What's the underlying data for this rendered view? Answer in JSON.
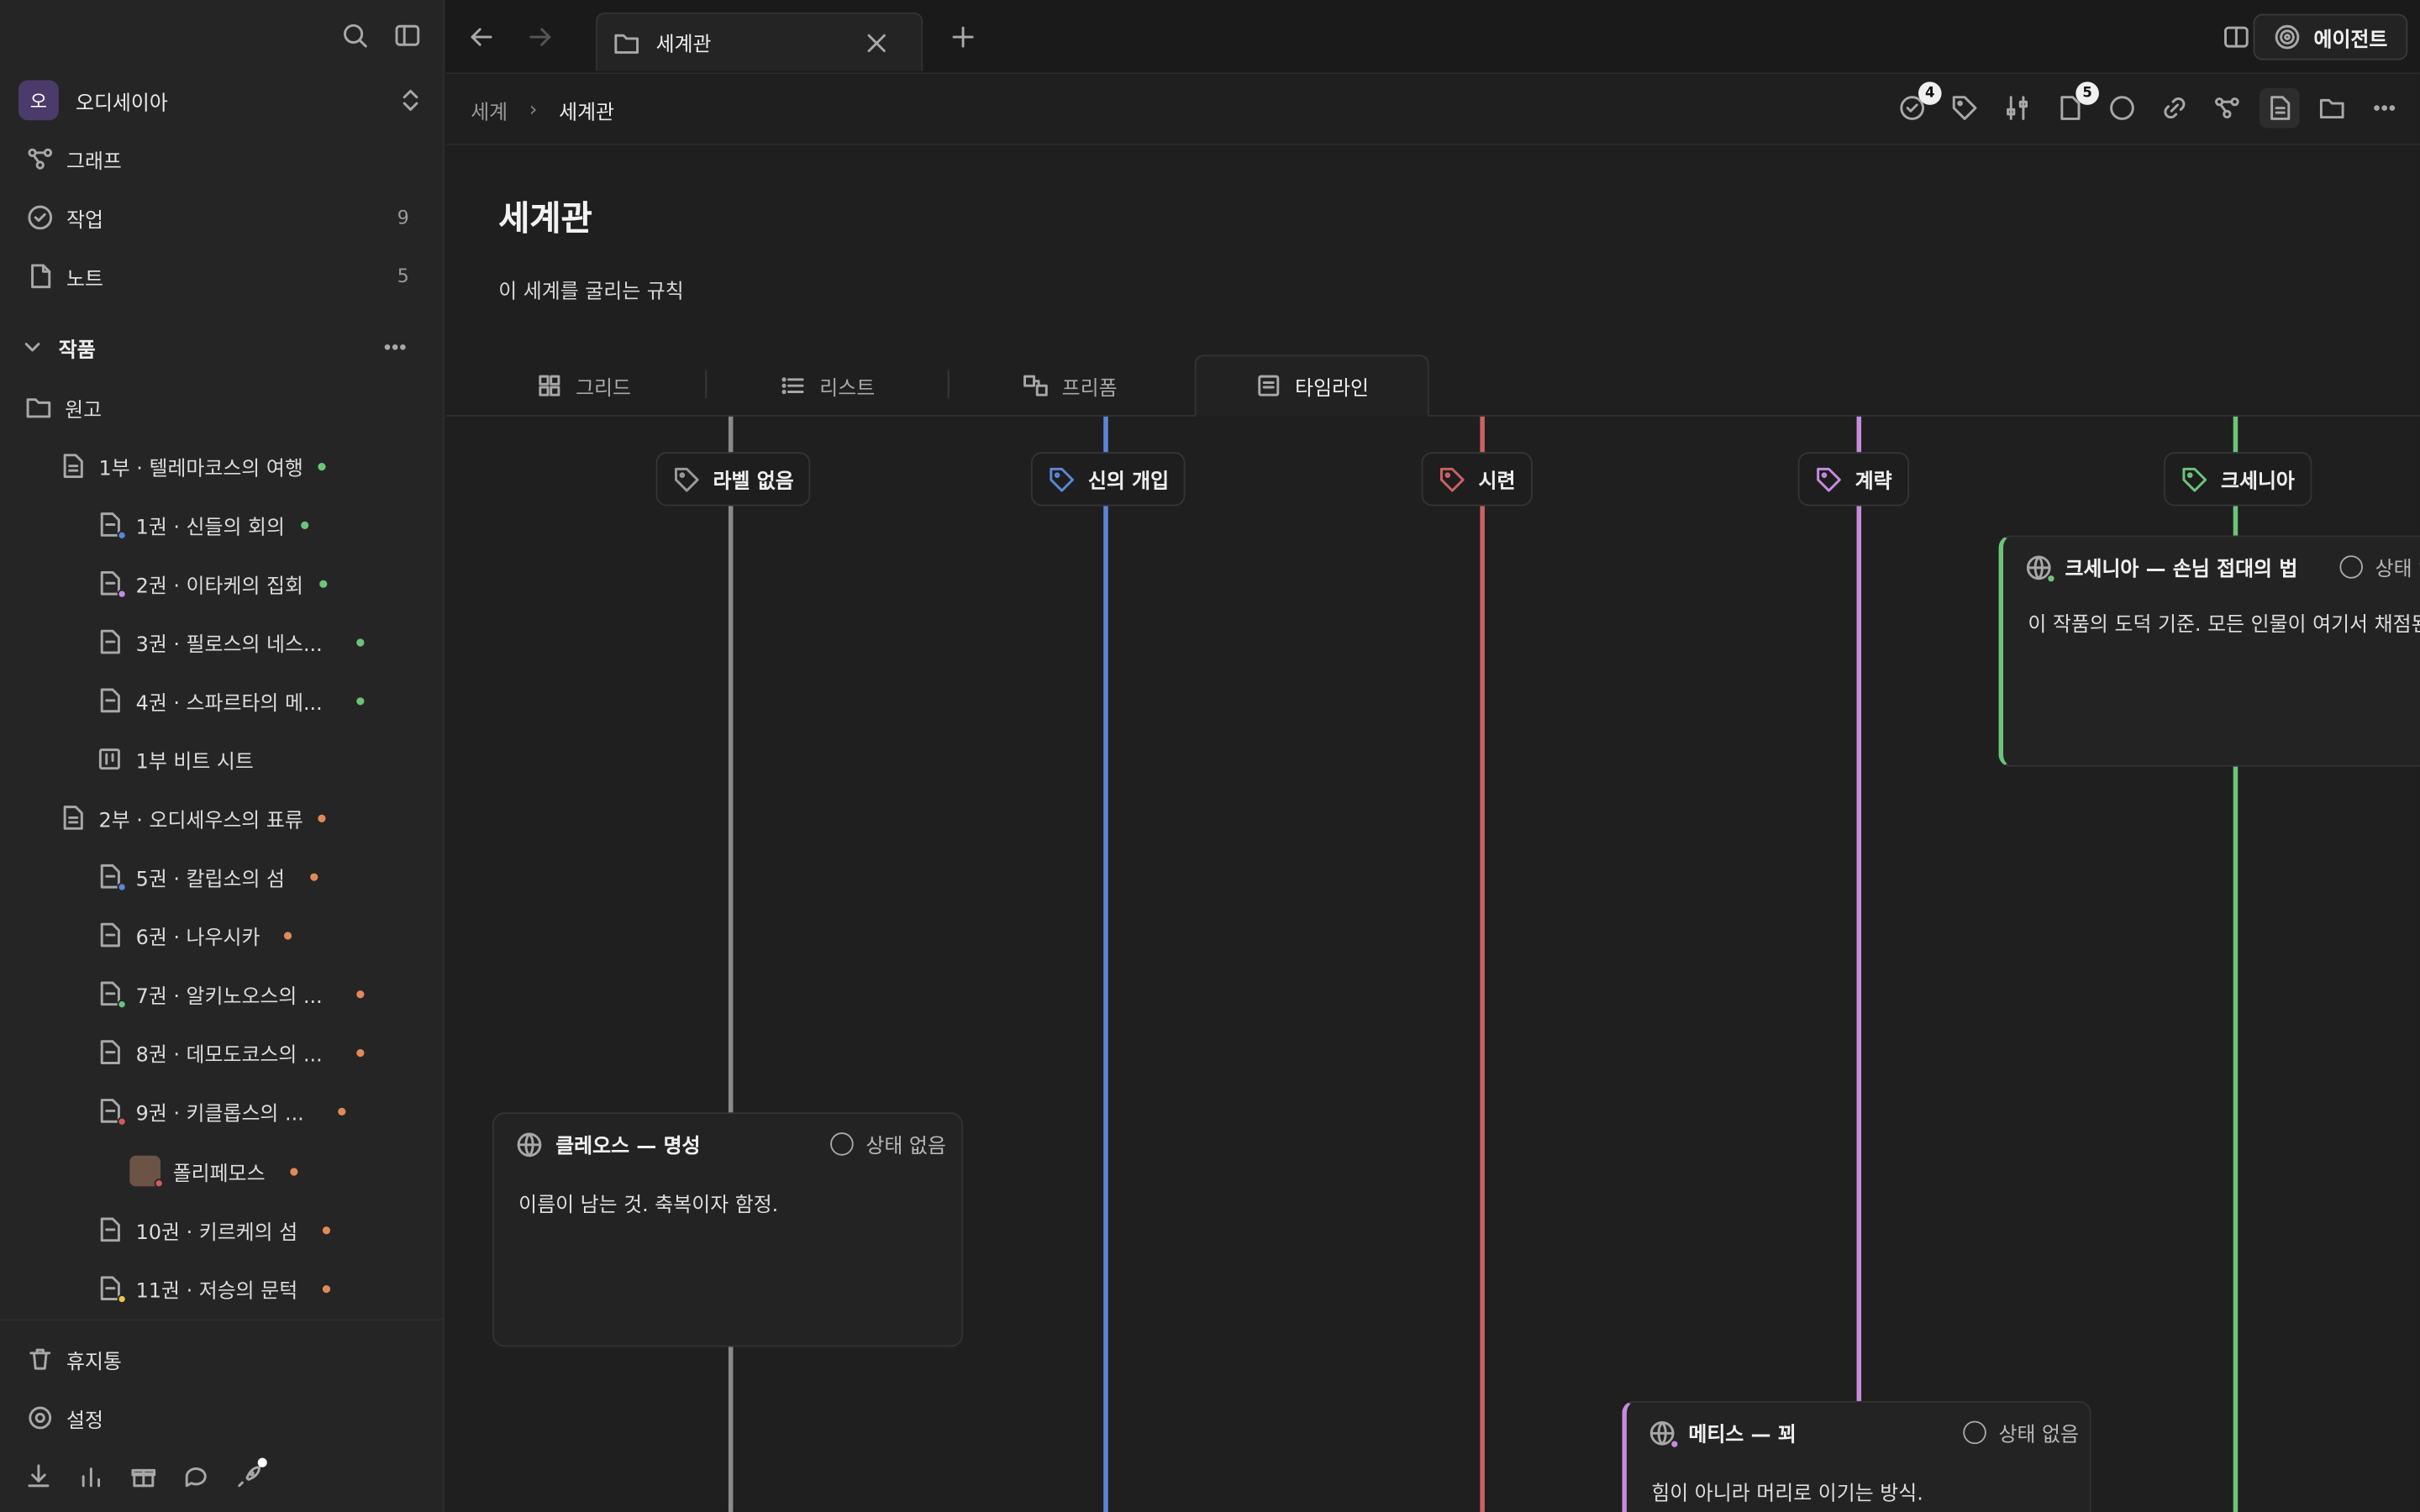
{
  "sidebar": {
    "workspace": {
      "initial": "오",
      "name": "오디세이아"
    },
    "nav": [
      {
        "label": "그래프",
        "count": ""
      },
      {
        "label": "작업",
        "count": "9"
      },
      {
        "label": "노트",
        "count": "5"
      }
    ],
    "section": {
      "label": "작품"
    },
    "tree": [
      {
        "label": "원고"
      },
      {
        "label": "1부 · 텔레마코스의 여행"
      },
      {
        "label": "1권 · 신들의 회의"
      },
      {
        "label": "2권 · 이타케의 집회"
      },
      {
        "label": "3권 · 필로스의 네스..."
      },
      {
        "label": "4권 · 스파르타의 메..."
      },
      {
        "label": "1부 비트 시트"
      },
      {
        "label": "2부 · 오디세우스의 표류"
      },
      {
        "label": "5권 · 칼립소의 섬"
      },
      {
        "label": "6권 · 나우시카"
      },
      {
        "label": "7권 · 알키노오스의 ..."
      },
      {
        "label": "8권 · 데모도코스의 ..."
      },
      {
        "label": "9권 · 키클롭스의 ..."
      },
      {
        "label": "폴리페모스"
      },
      {
        "label": "10권 · 키르케의 섬"
      },
      {
        "label": "11권 · 저승의 문턱"
      }
    ],
    "footer": {
      "trash": "휴지통",
      "settings": "설정"
    },
    "colors": {
      "green": "#6cc478",
      "orange": "#e08a5a",
      "blue": "#5b86d6",
      "purple": "#c58be0",
      "red": "#d45a5a",
      "yellow": "#e8c34a"
    }
  },
  "topbar": {
    "tab_title": "세계관",
    "agent_label": "에이전트"
  },
  "breadcrumb": {
    "parent": "세계",
    "current": "세계관"
  },
  "toolbar": {
    "tasks_badge": "4",
    "notes_badge": "5"
  },
  "page": {
    "title": "세계관",
    "description": "이 세계를 굴리는 규칙"
  },
  "views": [
    {
      "label": "그리드"
    },
    {
      "label": "리스트"
    },
    {
      "label": "프리폼"
    },
    {
      "label": "타임라인"
    }
  ],
  "lanes": [
    {
      "label": "라벨 없음",
      "color": "#8a8a8a"
    },
    {
      "label": "신의 개입",
      "color": "#5b86d6"
    },
    {
      "label": "시련",
      "color": "#c96262"
    },
    {
      "label": "계략",
      "color": "#c78be0"
    },
    {
      "label": "크세니아",
      "color": "#6cc478"
    }
  ],
  "cards": [
    {
      "title": "클레오스 — 명성",
      "status": "상태 없음",
      "body": "이름이 남는 것. 축복이자 함정."
    },
    {
      "title": "크세니아 — 손님 접대의 법",
      "status": "상태 없음",
      "body": "이 작품의 도덕 기준. 모든 인물이 여기서 채점된다"
    },
    {
      "title": "메티스 — 꾀",
      "status": "상태 없음",
      "body": "힘이 아니라 머리로 이기는 방식."
    }
  ]
}
